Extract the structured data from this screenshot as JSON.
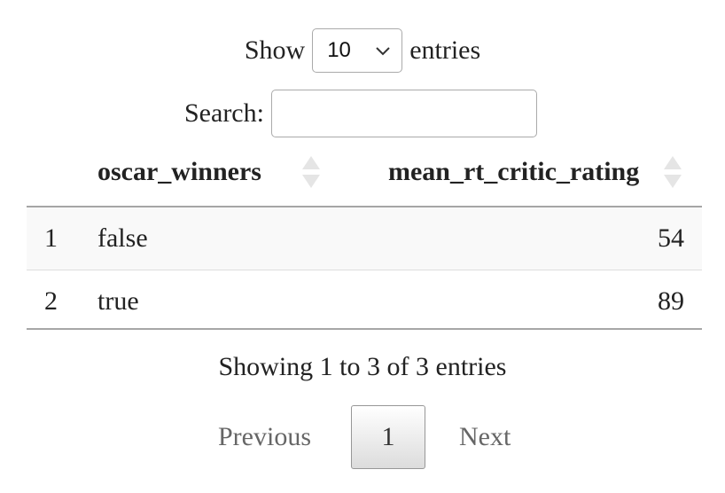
{
  "length": {
    "prefix": "Show",
    "value": "10",
    "suffix": "entries"
  },
  "search": {
    "label": "Search:",
    "value": ""
  },
  "table": {
    "columns": [
      "oscar_winners",
      "mean_rt_critic_rating"
    ],
    "rows": [
      {
        "index": "1",
        "oscar_winners": "false",
        "mean_rt_critic_rating": "54"
      },
      {
        "index": "2",
        "oscar_winners": "true",
        "mean_rt_critic_rating": "89"
      }
    ]
  },
  "info": "Showing 1 to 3 of 3 entries",
  "pagination": {
    "previous": "Previous",
    "current": "1",
    "next": "Next"
  }
}
